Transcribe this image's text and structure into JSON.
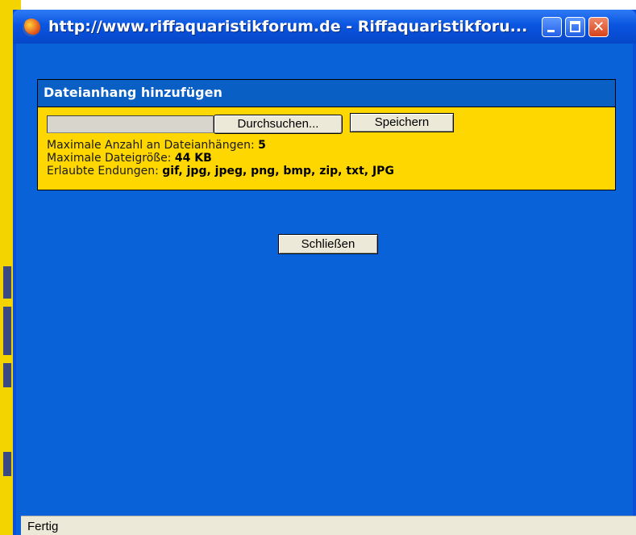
{
  "window": {
    "title": "http://www.riffaquaristikforum.de - Riffaquaristikforu..."
  },
  "panel": {
    "title": "Dateianhang hinzufügen",
    "browse_label": "Durchsuchen...",
    "save_label": "Speichern",
    "file_value": "",
    "max_attachments_label": "Maximale Anzahl an Dateianhängen:",
    "max_attachments_value": "5",
    "max_size_label": "Maximale Dateigröße:",
    "max_size_value": "44 KB",
    "extensions_label": "Erlaubte Endungen:",
    "extensions_value": "gif, jpg, jpeg, png, bmp, zip, txt, JPG"
  },
  "close_label": "Schließen",
  "status": {
    "text": "Fertig"
  },
  "colors": {
    "window_background": "#0a62d8",
    "panel_header": "#0a5fc4",
    "panel_body": "#ffd700"
  }
}
